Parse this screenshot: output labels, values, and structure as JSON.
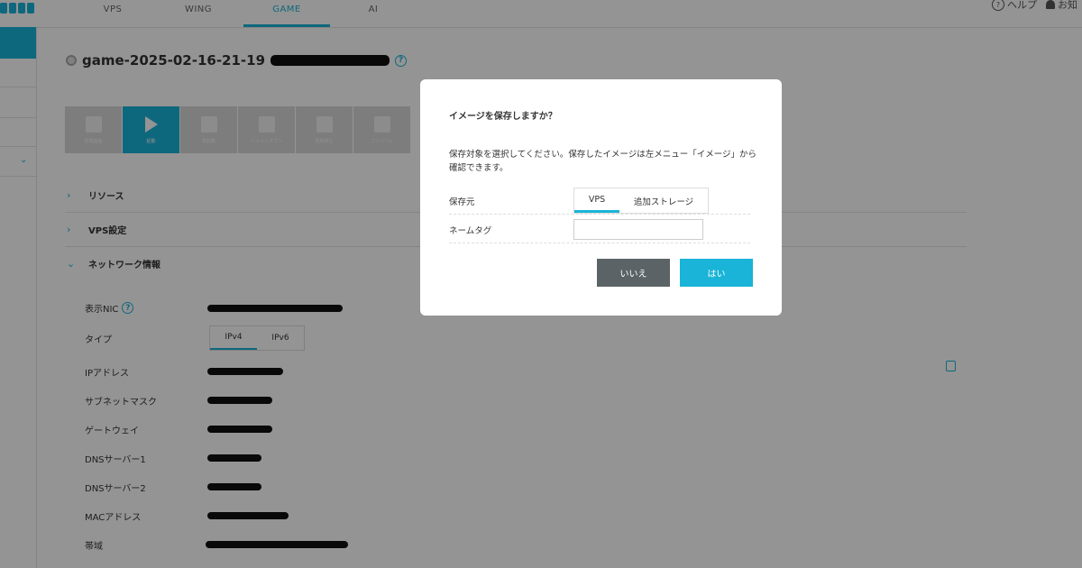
{
  "header": {
    "tabs": [
      {
        "label": "VPS",
        "active": false
      },
      {
        "label": "WING",
        "active": false
      },
      {
        "label": "GAME",
        "active": true
      },
      {
        "label": "AI",
        "active": false
      }
    ],
    "help_label": "ヘルプ",
    "notice_label": "お知"
  },
  "server": {
    "title": "game-2025-02-16-21-19"
  },
  "toolbar": {
    "items": [
      {
        "icon": "external-window-icon",
        "label": "管理画面"
      },
      {
        "icon": "play-icon",
        "label": "起動",
        "active": true
      },
      {
        "icon": "restart-icon",
        "label": "再起動"
      },
      {
        "icon": "stop-icon",
        "label": "シャットダウン"
      },
      {
        "icon": "force-stop-icon",
        "label": "強制停止"
      },
      {
        "icon": "console-icon",
        "label": "コンソール"
      }
    ]
  },
  "sections": {
    "resources": "リソース",
    "vps_settings": "VPS設定",
    "network_info": "ネットワーク情報"
  },
  "network": {
    "display_nic_label": "表示NIC",
    "type_label": "タイプ",
    "type_options": [
      "IPv4",
      "IPv6"
    ],
    "type_selected": "IPv4",
    "ip_label": "IPアドレス",
    "subnet_label": "サブネットマスク",
    "gateway_label": "ゲートウェイ",
    "dns1_label": "DNSサーバー1",
    "dns2_label": "DNSサーバー2",
    "mac_label": "MACアドレス",
    "bandwidth_label": "帯域"
  },
  "modal": {
    "title": "イメージを保存しますか？",
    "description": "保存対象を選択してください。保存したイメージは左メニュー「イメージ」から確認できます。",
    "source_label": "保存元",
    "source_options": [
      "VPS",
      "追加ストレージ"
    ],
    "source_selected": "VPS",
    "nametag_label": "ネームタグ",
    "nametag_value": "",
    "no_label": "いいえ",
    "yes_label": "はい"
  },
  "colors": {
    "accent": "#19b4d7",
    "secondary_button": "#5b6366"
  }
}
